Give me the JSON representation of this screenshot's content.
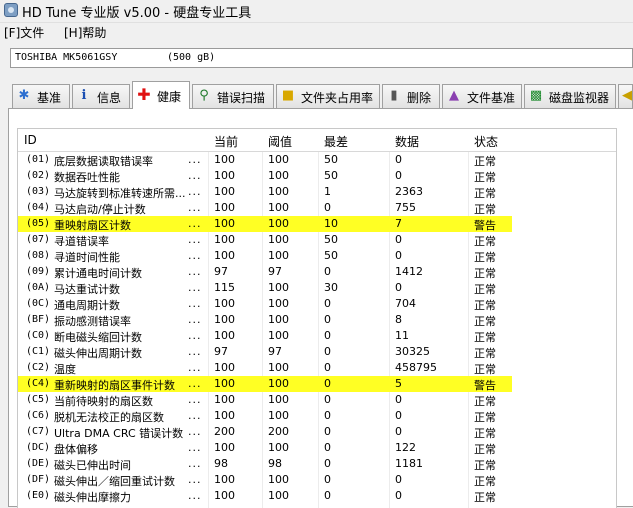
{
  "window": {
    "title": "HD Tune 专业版 v5.00 - 硬盘专业工具"
  },
  "menu": [
    {
      "label": "[F]文件"
    },
    {
      "label": "[H]帮助"
    }
  ],
  "drive": {
    "model": "TOSHIBA MK5061GSY",
    "size": "(500 gB)"
  },
  "tabs": [
    {
      "label": "基准",
      "icon": "benchmark-icon",
      "active": false
    },
    {
      "label": "信息",
      "icon": "info-icon",
      "active": false
    },
    {
      "label": "健康",
      "icon": "health-cross-icon",
      "active": true
    },
    {
      "label": "错误扫描",
      "icon": "magnifier-icon",
      "active": false
    },
    {
      "label": "文件夹占用率",
      "icon": "folder-icon",
      "active": false
    },
    {
      "label": "删除",
      "icon": "trash-icon",
      "active": false
    },
    {
      "label": "文件基准",
      "icon": "file-benchmark-icon",
      "active": false
    },
    {
      "label": "磁盘监视器",
      "icon": "disk-monitor-icon",
      "active": false
    },
    {
      "label": "",
      "icon": "more-icon",
      "active": false
    }
  ],
  "table": {
    "headers": {
      "id": "ID",
      "current": "当前",
      "threshold": "阈值",
      "worst": "最差",
      "data": "数据",
      "status": "状态"
    },
    "highlight_color": "#ffff24",
    "rows": [
      {
        "id": "(01)",
        "name": "底层数据读取错误率",
        "current": "100",
        "threshold": "100",
        "worst": "50",
        "data": "0",
        "status": "正常",
        "warn": false
      },
      {
        "id": "(02)",
        "name": "数据吞吐性能",
        "current": "100",
        "threshold": "100",
        "worst": "50",
        "data": "0",
        "status": "正常",
        "warn": false
      },
      {
        "id": "(03)",
        "name": "马达旋转到标准转速所需...",
        "current": "100",
        "threshold": "100",
        "worst": "1",
        "data": "2363",
        "status": "正常",
        "warn": false
      },
      {
        "id": "(04)",
        "name": "马达启动/停止计数",
        "current": "100",
        "threshold": "100",
        "worst": "0",
        "data": "755",
        "status": "正常",
        "warn": false
      },
      {
        "id": "(05)",
        "name": "重映射扇区计数",
        "current": "100",
        "threshold": "100",
        "worst": "10",
        "data": "7",
        "status": "警告",
        "warn": true
      },
      {
        "id": "(07)",
        "name": "寻道错误率",
        "current": "100",
        "threshold": "100",
        "worst": "50",
        "data": "0",
        "status": "正常",
        "warn": false
      },
      {
        "id": "(08)",
        "name": "寻道时间性能",
        "current": "100",
        "threshold": "100",
        "worst": "50",
        "data": "0",
        "status": "正常",
        "warn": false
      },
      {
        "id": "(09)",
        "name": "累计通电时间计数",
        "current": "97",
        "threshold": "97",
        "worst": "0",
        "data": "1412",
        "status": "正常",
        "warn": false
      },
      {
        "id": "(0A)",
        "name": "马达重试计数",
        "current": "115",
        "threshold": "100",
        "worst": "30",
        "data": "0",
        "status": "正常",
        "warn": false
      },
      {
        "id": "(0C)",
        "name": "通电周期计数",
        "current": "100",
        "threshold": "100",
        "worst": "0",
        "data": "704",
        "status": "正常",
        "warn": false
      },
      {
        "id": "(BF)",
        "name": "振动感测错误率",
        "current": "100",
        "threshold": "100",
        "worst": "0",
        "data": "8",
        "status": "正常",
        "warn": false
      },
      {
        "id": "(C0)",
        "name": "断电磁头缩回计数",
        "current": "100",
        "threshold": "100",
        "worst": "0",
        "data": "11",
        "status": "正常",
        "warn": false
      },
      {
        "id": "(C1)",
        "name": "磁头伸出周期计数",
        "current": "97",
        "threshold": "97",
        "worst": "0",
        "data": "30325",
        "status": "正常",
        "warn": false
      },
      {
        "id": "(C2)",
        "name": "温度",
        "current": "100",
        "threshold": "100",
        "worst": "0",
        "data": "458795",
        "status": "正常",
        "warn": false
      },
      {
        "id": "(C4)",
        "name": "重新映射的扇区事件计数",
        "current": "100",
        "threshold": "100",
        "worst": "0",
        "data": "5",
        "status": "警告",
        "warn": true
      },
      {
        "id": "(C5)",
        "name": "当前待映射的扇区数",
        "current": "100",
        "threshold": "100",
        "worst": "0",
        "data": "0",
        "status": "正常",
        "warn": false
      },
      {
        "id": "(C6)",
        "name": "脱机无法校正的扇区数",
        "current": "100",
        "threshold": "100",
        "worst": "0",
        "data": "0",
        "status": "正常",
        "warn": false
      },
      {
        "id": "(C7)",
        "name": "Ultra DMA CRC 错误计数",
        "current": "200",
        "threshold": "200",
        "worst": "0",
        "data": "0",
        "status": "正常",
        "warn": false
      },
      {
        "id": "(DC)",
        "name": "盘体偏移",
        "current": "100",
        "threshold": "100",
        "worst": "0",
        "data": "122",
        "status": "正常",
        "warn": false
      },
      {
        "id": "(DE)",
        "name": "磁头已伸出时间",
        "current": "98",
        "threshold": "98",
        "worst": "0",
        "data": "1181",
        "status": "正常",
        "warn": false
      },
      {
        "id": "(DF)",
        "name": "磁头伸出／缩回重试计数",
        "current": "100",
        "threshold": "100",
        "worst": "0",
        "data": "0",
        "status": "正常",
        "warn": false
      },
      {
        "id": "(E0)",
        "name": "磁头伸出摩擦力",
        "current": "100",
        "threshold": "100",
        "worst": "0",
        "data": "0",
        "status": "正常",
        "warn": false
      }
    ]
  }
}
